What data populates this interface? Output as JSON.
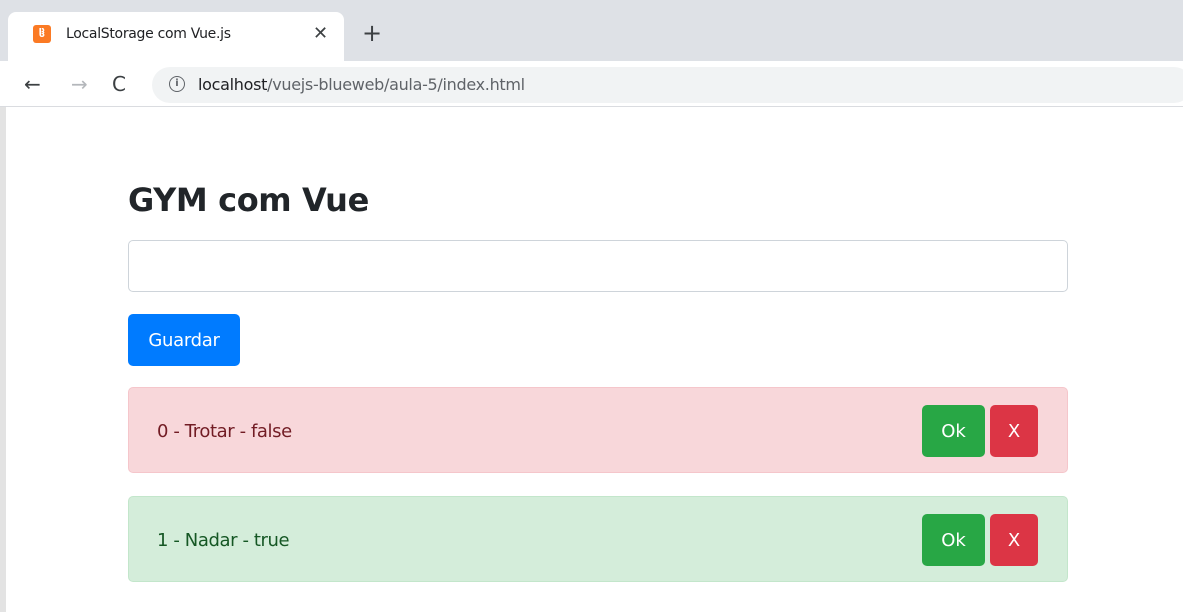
{
  "browser": {
    "tab_title": "LocalStorage com Vue.js",
    "tab_favicon_icon": "xampp-icon",
    "tab_close_glyph": "✕",
    "new_tab_glyph": "+",
    "back_glyph": "←",
    "forward_glyph": "→",
    "reload_glyph": "C",
    "info_glyph": "i",
    "url_host": "localhost",
    "url_path": "/vuejs-blueweb/aula-5/index.html"
  },
  "page": {
    "title": "GYM com Vue",
    "input": {
      "value": "",
      "placeholder": ""
    },
    "save_label": "Guardar",
    "tasks": [
      {
        "text": "0 - Trotar - false",
        "state": "danger",
        "ok_label": "Ok",
        "delete_label": "X"
      },
      {
        "text": "1 - Nadar - true",
        "state": "success",
        "ok_label": "Ok",
        "delete_label": "X"
      }
    ]
  },
  "colors": {
    "primary": "#007bff",
    "success_button": "#28a745",
    "danger_button": "#dc3545",
    "alert_danger_bg": "#f8d7da",
    "alert_success_bg": "#d4edda"
  }
}
